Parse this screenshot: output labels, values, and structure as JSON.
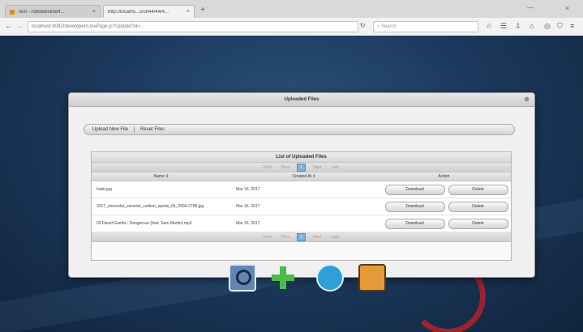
{
  "browser": {
    "tabs": [
      {
        "label": "Test - robotdeskhelf...",
        "active": false
      },
      {
        "label": "http://localho...s/ch44/44/4...",
        "active": true
      }
    ],
    "url": "localhost:8082/developer/LinePage.js?Update?id=...",
    "search_placeholder": "Search"
  },
  "dialog": {
    "title": "Uploaded Files",
    "actions": [
      "Upload New File",
      "Reset Files"
    ],
    "list_title": "List of Uploaded Files",
    "pager": {
      "first": "First",
      "prev": "Prev",
      "current": "1",
      "next": "Next",
      "last": "Last"
    },
    "columns": {
      "name": "Name",
      "created": "Created At",
      "action": "Action"
    },
    "rows": [
      {
        "name": "Ixato.jpg",
        "date": "Mar 16, 2017",
        "download": "Download",
        "delete": "Delete"
      },
      {
        "name": "2017_chevrolet_corvette_carbon_sports_66_2904-2788.jpg",
        "date": "Mar 16, 2017",
        "download": "Download",
        "delete": "Delete"
      },
      {
        "name": "03 David Guetta - Dangerous (feat. Sam Martin).mp3",
        "date": "Mar 16, 2017",
        "download": "Download",
        "delete": "Delete"
      }
    ]
  },
  "colors": {
    "accent_page": "#7fb0d8",
    "desktop_bg": "#1c3a5e",
    "swirl": "#b3222b"
  },
  "dock_icons": [
    "search-icon",
    "add-icon",
    "share-icon",
    "exit-icon"
  ]
}
